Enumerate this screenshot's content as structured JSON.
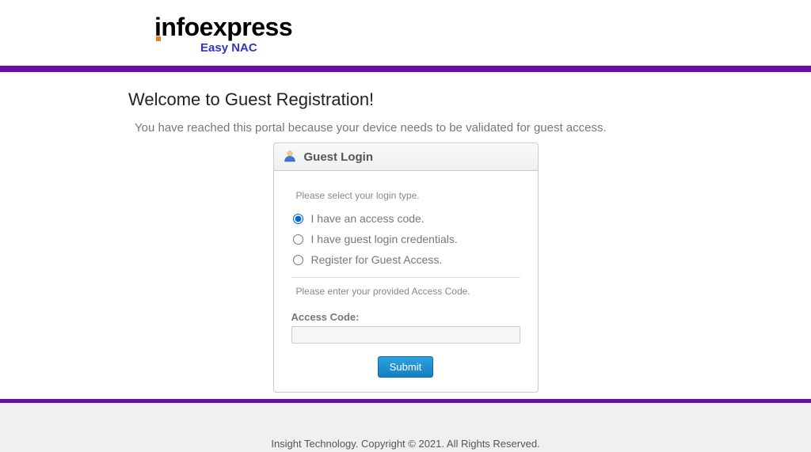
{
  "brand": {
    "name": "infoexpress",
    "sub": "Easy NAC"
  },
  "page": {
    "title": "Welcome to Guest Registration!",
    "subtitle": "You have reached this portal because your device needs to be validated for guest access."
  },
  "login": {
    "header": "Guest Login",
    "select_instruction": "Please select your login type.",
    "options": {
      "access_code": "I have an access code.",
      "guest_creds": "I have guest login credentials.",
      "register": "Register for Guest Access."
    },
    "enter_instruction": "Please enter your provided Access Code.",
    "access_code_label": "Access Code:",
    "access_code_value": "",
    "submit_label": "Submit"
  },
  "footer": {
    "text": "Insight Technology. Copyright © 2021. All Rights Reserved."
  }
}
